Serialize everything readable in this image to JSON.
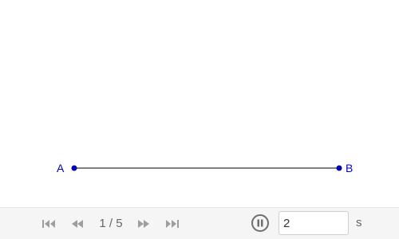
{
  "canvas": {
    "segment": {
      "point_a": "A",
      "point_b": "B",
      "point_color": "#0000cc",
      "line_color": "#555555"
    }
  },
  "playback": {
    "step_counter": "1 / 5",
    "speed_value": "2",
    "speed_unit": "s",
    "controls": [
      "first-step-icon",
      "previous-step-icon",
      "next-step-icon",
      "last-step-icon",
      "pause-icon"
    ]
  }
}
